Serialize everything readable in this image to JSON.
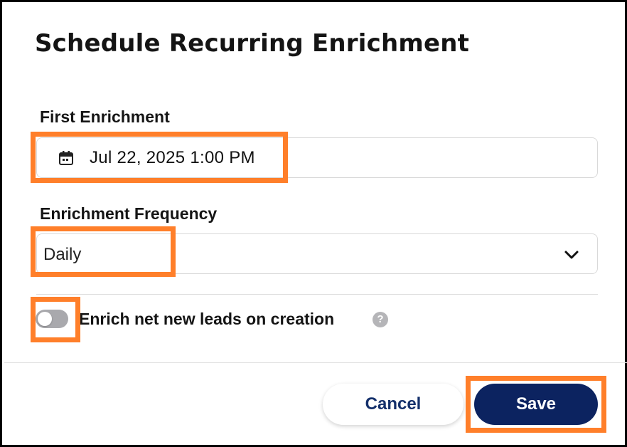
{
  "dialog": {
    "title": "Schedule Recurring Enrichment"
  },
  "first_enrichment": {
    "label": "First Enrichment",
    "value": "Jul 22, 2025 1:00 PM",
    "icon": "calendar-icon"
  },
  "frequency": {
    "label": "Enrichment Frequency",
    "selected": "Daily",
    "icon": "chevron-down-icon"
  },
  "net_new_leads": {
    "label": "Enrich net new leads on creation",
    "enabled": false,
    "help_icon": "question-mark-icon",
    "help_glyph": "?"
  },
  "footer": {
    "cancel_label": "Cancel",
    "save_label": "Save"
  },
  "colors": {
    "highlight": "#ff7f2a",
    "save_bg": "#0c2360",
    "cancel_text": "#14306b",
    "toggle_off": "#a9a9ad"
  }
}
